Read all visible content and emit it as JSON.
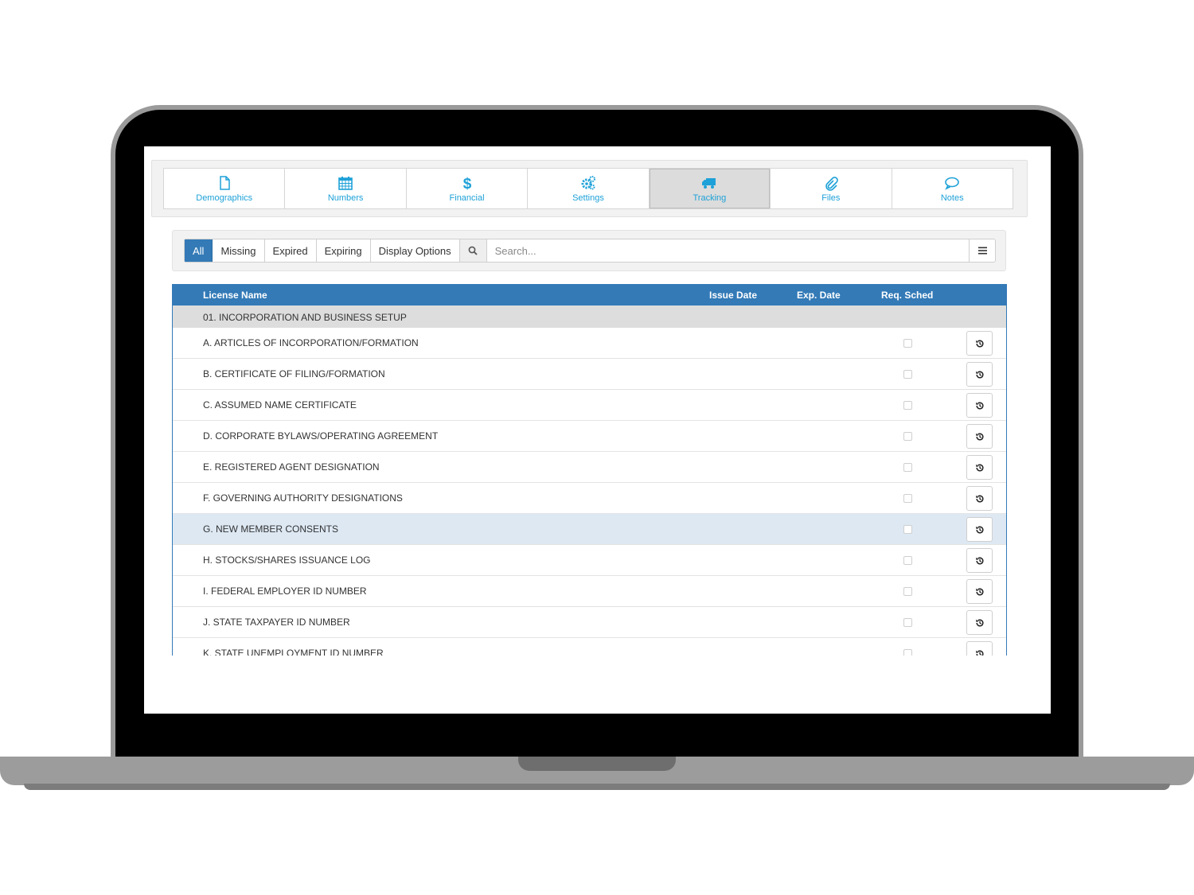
{
  "tabs": [
    {
      "label": "Demographics",
      "icon": "file-icon"
    },
    {
      "label": "Numbers",
      "icon": "calendar-icon"
    },
    {
      "label": "Financial",
      "icon": "dollar-icon"
    },
    {
      "label": "Settings",
      "icon": "gears-icon"
    },
    {
      "label": "Tracking",
      "icon": "truck-icon",
      "active": true
    },
    {
      "label": "Files",
      "icon": "paperclip-icon"
    },
    {
      "label": "Notes",
      "icon": "speech-bubble-icon"
    }
  ],
  "filters": {
    "all": "All",
    "missing": "Missing",
    "expired": "Expired",
    "expiring": "Expiring",
    "display_options": "Display Options"
  },
  "search": {
    "placeholder": "Search...",
    "value": ""
  },
  "table": {
    "columns": {
      "name": "License Name",
      "issue": "Issue Date",
      "exp": "Exp. Date",
      "req": "Req. Sched"
    },
    "group": "01. INCORPORATION AND BUSINESS SETUP",
    "rows": [
      "A. ARTICLES OF INCORPORATION/FORMATION",
      "B. CERTIFICATE OF FILING/FORMATION",
      "C. ASSUMED NAME CERTIFICATE",
      "D. CORPORATE BYLAWS/OPERATING AGREEMENT",
      "E. REGISTERED AGENT DESIGNATION",
      "F. GOVERNING AUTHORITY DESIGNATIONS",
      "G. NEW MEMBER CONSENTS",
      "H. STOCKS/SHARES ISSUANCE LOG",
      "I. FEDERAL EMPLOYER ID NUMBER",
      "J. STATE TAXPAYER ID NUMBER",
      "K. STATE UNEMPLOYMENT ID NUMBER"
    ],
    "highlighted_row": 6
  },
  "colors": {
    "accent": "#337ab7",
    "tab_icon": "#1ea1d8",
    "highlight": "#dde8f3"
  }
}
